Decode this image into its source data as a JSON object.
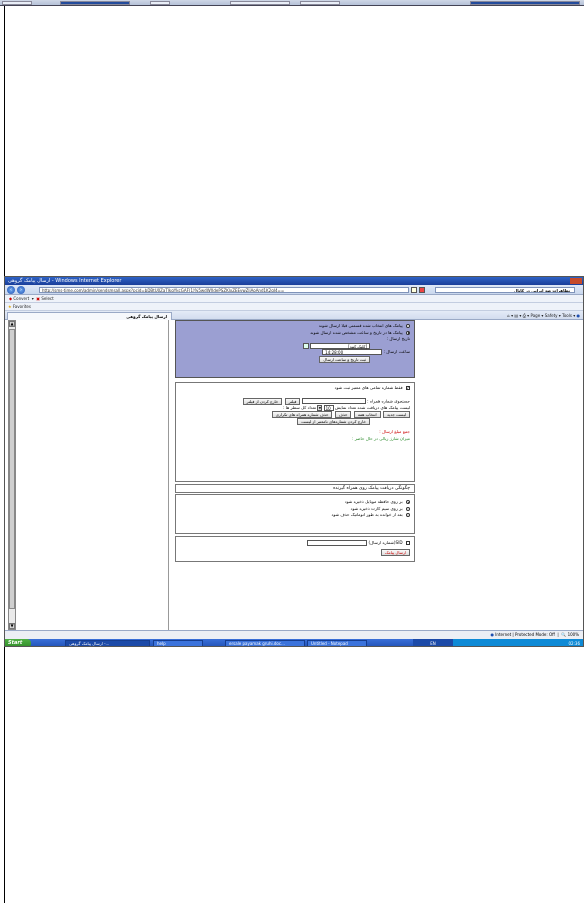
{
  "window": {
    "title": "ارسال پیامک گروهی - Windows Internet Explorer",
    "url": "http://sms-time.com/admin/sendsmsall.aspx?pcid=bDBtU0ZaTlkgYkcGAF(1)%5wdWXdePSZKlxZEEvwZljAoAnd1K2gI4==",
    "search_text": "تظاهرات ضد ایرانی در کانال"
  },
  "command_bar": {
    "convert": "Convert",
    "select": "Select"
  },
  "favorites_bar": {
    "favorites": "Favorites"
  },
  "tab": {
    "label": "ارسال پیامک گروهی"
  },
  "tools_bar": {
    "page": "Page",
    "safety": "Safety",
    "tools": "Tools"
  },
  "send_time": {
    "option_selected_msgs": "پیامک های انتخاب شده قسمتی قبلا ارسال شوند",
    "option_date_time": "پیامک ها در تاریخ و ساعت مشخص شده ارسال شوند",
    "date_label": "تاریخ ارسال :",
    "date_value": "[کلیک کنید]",
    "time_label": "ساعت ارسال :",
    "time_value": "14:28:00",
    "submit_button": "ثبت تاریخ و ساعت ارسال"
  },
  "numbers": {
    "valid_only_label": "فقط شماره تمامی های معتبر ثبت شود",
    "search_label": "جستجوی شماره همراه :",
    "filter_button": "فیلتر",
    "remove_filter_button": "خارج کردن از فیلتر",
    "list_label": "لیست پیامک های دریافت شده تعداد نمایش",
    "page_size_value": "10",
    "total_rows_label": "تعداد کل سطر ها :",
    "btn_new_list": "لیست جدید",
    "btn_select_all": "انتخاب همه",
    "btn_delete": "حذف",
    "btn_delete_duplicates": "حذف شماره همراه های تکراری",
    "btn_remove_invalid": "خارج کردن شماره‌های نامعتبر از لیست",
    "send_total_label": "جمع مبلغ ارسال :",
    "current_credit_label": "میزان شارژ ریالی در حال حاضر :"
  },
  "delivery": {
    "title": "چگونگی دریافت پیامک روی همراه گیرنده",
    "opt_memory": "بر روی حافظه موبایل ذخیره شود",
    "opt_sim": "بر روی سیم کارت ذخیره شود",
    "opt_auto_delete": "بعد از خوانده به طور اتوماتیک حذف شود"
  },
  "send": {
    "sid_label": "SID(شماره ارسال)",
    "sid_value": "",
    "send_button": "ارسال پیامک"
  },
  "status": {
    "zone": "Internet | Protected Mode: Off",
    "zoom": "100%"
  },
  "taskbar": {
    "start": "Start",
    "items": [
      "ارسال پیامک گروهی -...",
      "help",
      "ersale payamak gruhi.doc...",
      "Untitled - Notepad"
    ],
    "lang": "EN",
    "clock": "02:36"
  }
}
